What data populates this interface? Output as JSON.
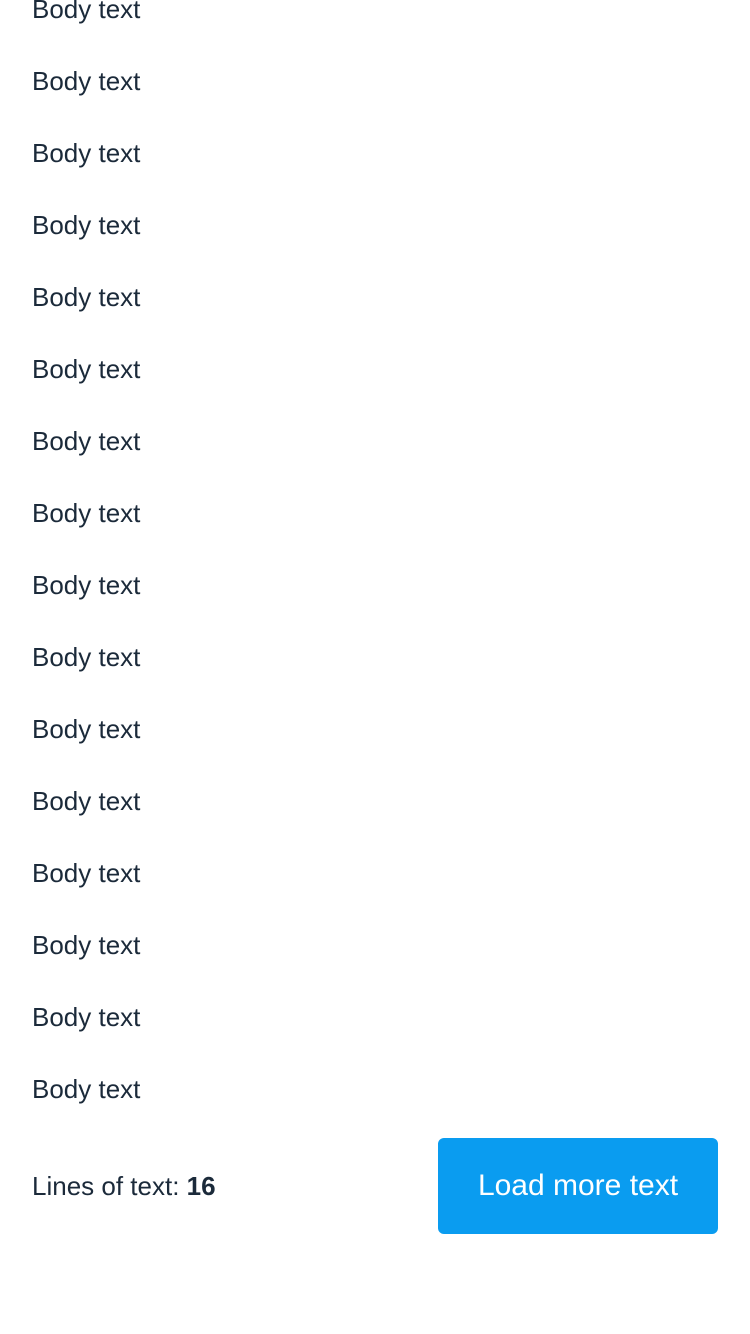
{
  "lines": [
    "Body text",
    "Body text",
    "Body text",
    "Body text",
    "Body text",
    "Body text",
    "Body text",
    "Body text",
    "Body text",
    "Body text",
    "Body text",
    "Body text",
    "Body text",
    "Body text",
    "Body text",
    "Body text"
  ],
  "footer": {
    "counter_label": "Lines of text:",
    "counter_value": "16",
    "button_label": "Load more text"
  },
  "colors": {
    "button_background": "#0a9cf0",
    "text": "#1b2a3a"
  }
}
